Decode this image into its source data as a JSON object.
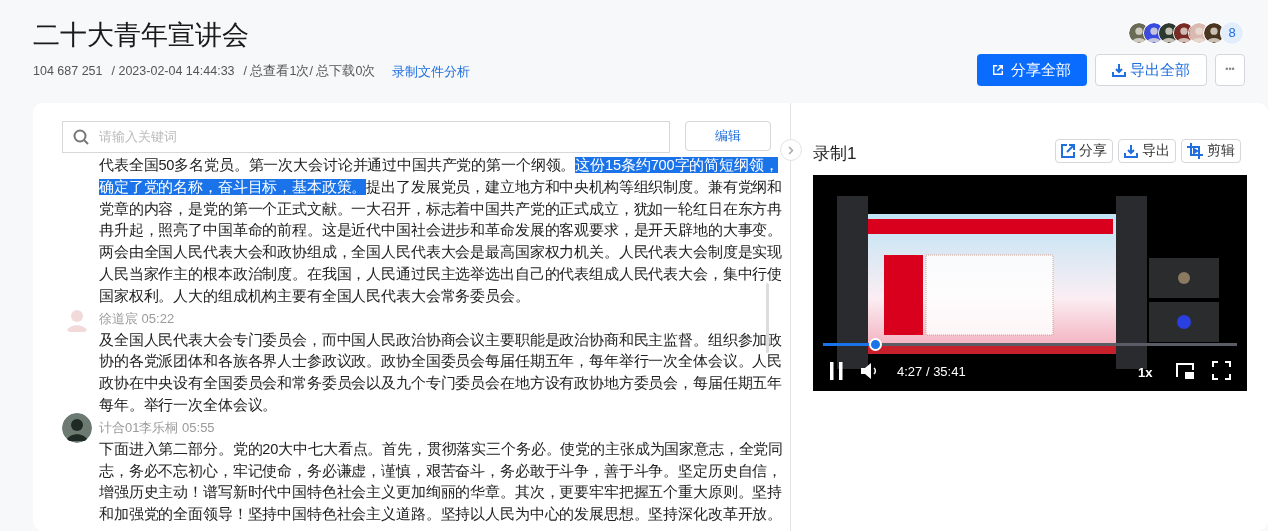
{
  "header": {
    "title": "二十大青年宣讲会",
    "meta": {
      "id": "104 687 251",
      "date": "/ 2023-02-04 14:44:33",
      "stats": "/ 总查看1次/ 总下载0次"
    },
    "analysis_link": "录制文件分析",
    "participants_more": "8",
    "buttons": [
      {
        "kind": "share",
        "label": "分享全部"
      },
      {
        "kind": "export",
        "label": "导出全部"
      },
      {
        "kind": "more",
        "label": "•••"
      }
    ]
  },
  "transcript": {
    "search": {
      "placeholder": "请输入关键词"
    },
    "edit_button": "编辑",
    "entries": [
      {
        "segments": [
          {
            "text": "代表全国50多名党员。第一次大会讨论并通过中国共产党的第一个纲领。",
            "selected": false
          },
          {
            "text": "这份15条约700字的简短纲领，确定了党的名称，奋斗目标，基本政策。",
            "selected": true
          },
          {
            "text": "提出了发展党员，建立地方和中央机构等组织制度。兼有党纲和党章的内容，是党的第一个正式文献。一大召开，标志着中国共产党的正式成立，犹如一轮红日在东方冉冉升起，照亮了中国革命的前程。这是近代中国社会进步和革命发展的客观要求，是开天辟地的大事变。两会由全国人民代表大会和政协组成，全国人民代表大会是最高国家权力机关。人民代表大会制度是实现人民当家作主的根本政治制度。在我国，人民通过民主选举选出自己的代表组成人民代表大会，集中行使国家权利。人大的组成机构主要有全国人民代表大会常务委员会。",
            "selected": false
          }
        ]
      },
      {
        "speaker": "徐道宸",
        "time": "05:22",
        "segments": [
          {
            "text": "及全国人民代表大会专门委员会，而中国人民政治协商会议主要职能是政治协商和民主监督。组织参加政协的各党派团体和各族各界人士参政议政。政协全国委员会每届任期五年，每年举行一次全体会议。人民政协在中央设有全国委员会和常务委员会以及九个专门委员会在地方设有政协地方委员会，每届任期五年每年。举行一次全体会议。",
            "selected": false
          }
        ]
      },
      {
        "speaker": "计合01李乐桐",
        "time": "05:55",
        "segments": [
          {
            "text": "下面进入第二部分。党的20大中七大看点。首先，贯彻落实三个务必。使党的主张成为国家意志，全党同志，务必不忘初心，牢记使命，务必谦虚，谨慎，艰苦奋斗，务必敢于斗争，善于斗争。坚定历史自信，增强历史主动！谱写新时代中国特色社会主义更加绚丽的华章。其次，更要牢牢把握五个重大原则。坚持和加强党的全面领导！坚持中国特色社会主义道路。坚持以人民为中心的发展思想。坚持深化改革开放。",
            "selected": false
          }
        ]
      }
    ]
  },
  "recording": {
    "title": "录制1",
    "buttons": [
      {
        "kind": "share",
        "label": "分享"
      },
      {
        "kind": "export",
        "label": "导出"
      },
      {
        "kind": "clip",
        "label": "剪辑"
      }
    ],
    "player": {
      "playing": true,
      "level": 0.125,
      "time": "4:27 / 35:41",
      "speed": "1x"
    }
  }
}
